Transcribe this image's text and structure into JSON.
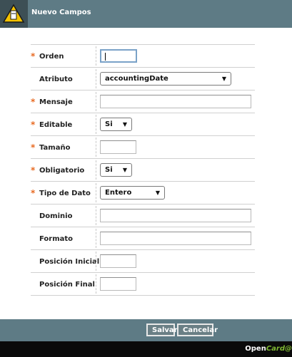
{
  "header": {
    "title": "Nuevo Campos",
    "icon": "edit-note-icon"
  },
  "form": {
    "fields": [
      {
        "label": "Orden",
        "required": true,
        "type": "text",
        "value": ""
      },
      {
        "label": "Atributo",
        "required": false,
        "type": "select",
        "value": "accountingDate"
      },
      {
        "label": "Mensaje",
        "required": true,
        "type": "text",
        "value": ""
      },
      {
        "label": "Editable",
        "required": true,
        "type": "select",
        "value": "Si"
      },
      {
        "label": "Tamaño",
        "required": true,
        "type": "text",
        "value": ""
      },
      {
        "label": "Obligatorio",
        "required": true,
        "type": "select",
        "value": "Si"
      },
      {
        "label": "Tipo de Dato",
        "required": true,
        "type": "select",
        "value": "Entero"
      },
      {
        "label": "Dominio",
        "required": false,
        "type": "text",
        "value": ""
      },
      {
        "label": "Formato",
        "required": false,
        "type": "text",
        "value": ""
      },
      {
        "label": "Posición Inicial",
        "required": false,
        "type": "text",
        "value": ""
      },
      {
        "label": "Posición Final",
        "required": false,
        "type": "text",
        "value": ""
      }
    ],
    "required_marker": "*"
  },
  "actions": {
    "save_label": "Salvar",
    "cancel_label": "Cancelar"
  },
  "brand": {
    "part1": "Open",
    "part2": "Card",
    "part3": "@",
    "accent_color": "#7fb832"
  },
  "colors": {
    "header_bg": "#5e7b85",
    "required_marker": "#e86a22"
  }
}
